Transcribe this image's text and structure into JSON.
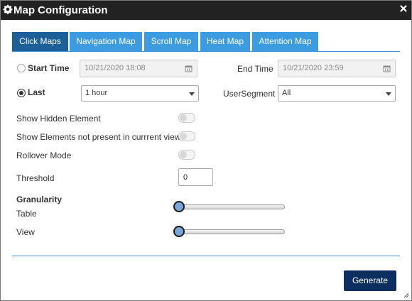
{
  "dialog": {
    "title": "Map Configuration"
  },
  "tabs": [
    {
      "label": "Click Maps",
      "active": true
    },
    {
      "label": "Navigation Map",
      "active": false
    },
    {
      "label": "Scroll Map",
      "active": false
    },
    {
      "label": "Heat Map",
      "active": false
    },
    {
      "label": "Attention Map",
      "active": false
    }
  ],
  "time": {
    "start_label": "Start Time",
    "start_value": "10/21/2020 18:08",
    "end_label": "End Time",
    "end_value": "10/21/2020 23:59",
    "selected_mode": "last"
  },
  "last": {
    "label": "Last",
    "value": "1 hour"
  },
  "user_segment": {
    "label": "UserSegment",
    "value": "All"
  },
  "toggles": {
    "show_hidden_label": "Show Hidden Element",
    "show_hidden_on": false,
    "show_not_present_label": "Show Elements not present in currrent view",
    "show_not_present_on": false,
    "rollover_label": "Rollover Mode",
    "rollover_on": false
  },
  "threshold": {
    "label": "Threshold",
    "value": "0"
  },
  "granularity": {
    "heading": "Granularity",
    "table_label": "Table",
    "table_level": 0,
    "view_label": "View",
    "view_level": 0
  },
  "actions": {
    "generate_label": "Generate"
  },
  "colors": {
    "titlebar": "#222222",
    "tab": "#3d9be0",
    "tab_active": "#1d5f98",
    "button": "#0d2f5f",
    "slider_thumb": "#7aa6da"
  },
  "icons": {
    "title": "gear-icon",
    "close": "close-icon",
    "date": "calendar-icon",
    "dropdown": "caret-down-icon",
    "resize": "resize-grip-icon"
  }
}
